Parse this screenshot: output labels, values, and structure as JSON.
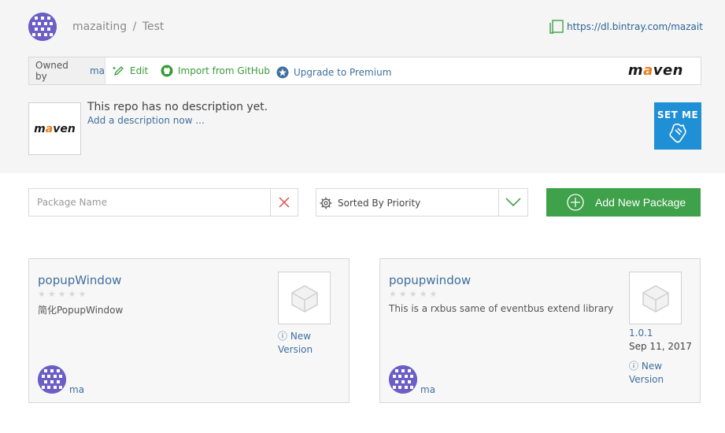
{
  "header": {
    "owner": "mazaiting",
    "separator": "/",
    "repo": "Test",
    "download_url": "https://dl.bintray.com/mazaiti..."
  },
  "owner_bar": {
    "owned_by_label": "Owned by",
    "owned_by_user": "ma",
    "edit_label": "Edit",
    "import_label": "Import from GitHub",
    "upgrade_label": "Upgrade to Premium",
    "logo_prefix": "m",
    "logo_accent": "a",
    "logo_suffix": "ven"
  },
  "repo_info": {
    "description": "This repo has no description yet.",
    "add_description": "Add a description now ...",
    "set_me_up_label": "SET ME"
  },
  "filters": {
    "search_placeholder": "Package Name",
    "sort_label": "Sorted By Priority",
    "add_package_label": "Add New Package"
  },
  "packages": [
    {
      "name": "popupWindow",
      "description": "简化PopupWindow",
      "rating": 0,
      "latest_version": "",
      "date": "",
      "new_version_line1": "New",
      "new_version_line2": "Version",
      "owner": "ma"
    },
    {
      "name": "popupwindow",
      "description": "This is a rxbus same of eventbus extend library",
      "rating": 0,
      "latest_version": "1.0.1",
      "date": "Sep 11, 2017",
      "new_version_line1": "New",
      "new_version_line2": "Version",
      "owner": "ma"
    }
  ],
  "colors": {
    "accent_green": "#3fa14a",
    "link_blue": "#3f6fa0",
    "setme_blue": "#1f8fd6",
    "avatar_purple": "#6b5fc7",
    "maven_orange": "#e67e22"
  }
}
